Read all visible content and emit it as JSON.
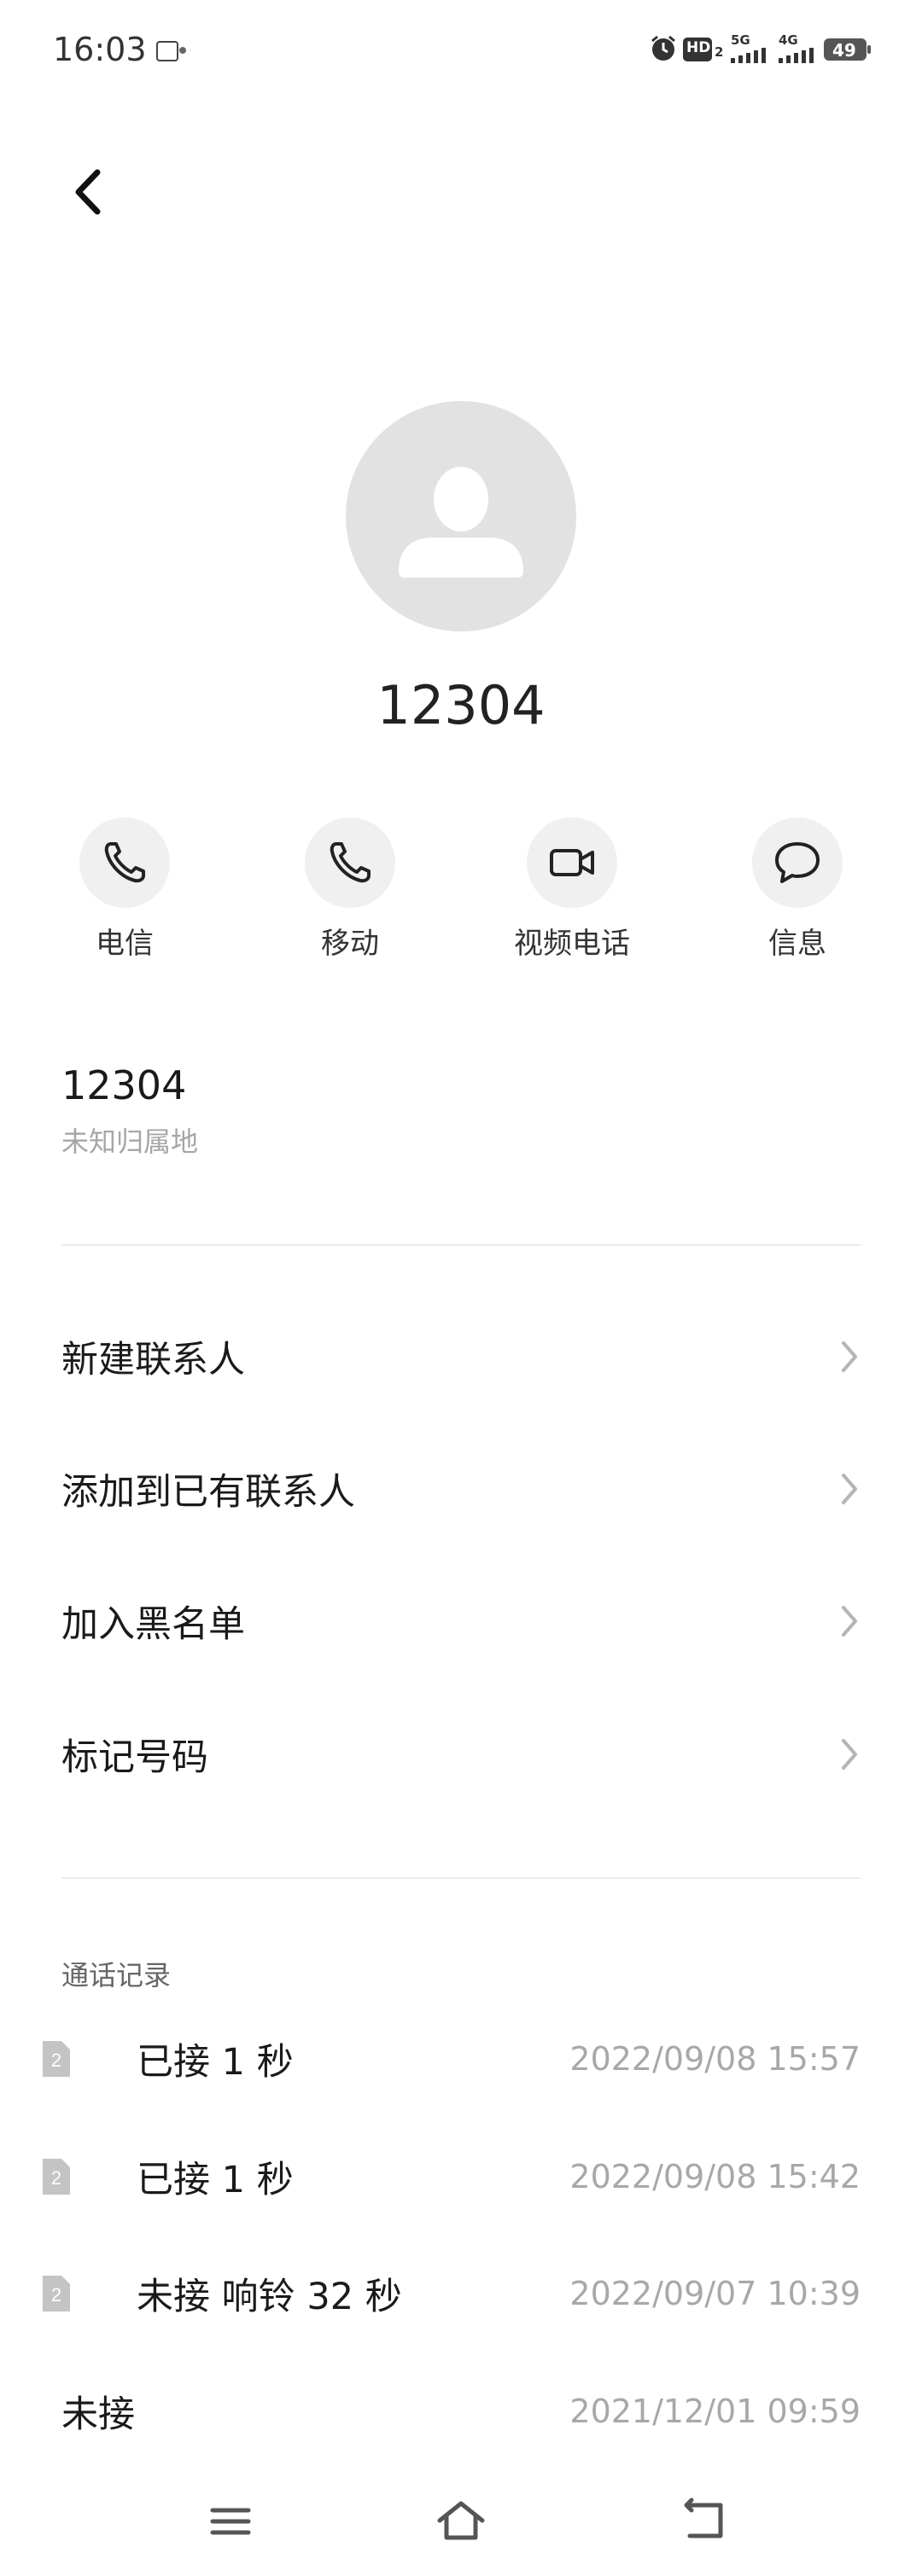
{
  "status_bar": {
    "time": "16:03",
    "hd_label": "HD",
    "hd_sub": "2",
    "signal1_label": "5G",
    "signal2_label": "4G",
    "battery": "49"
  },
  "header": {
    "back_icon": "back-arrow-icon"
  },
  "caller": {
    "number": "12304",
    "avatar_icon": "person-icon"
  },
  "actions": [
    {
      "label": "电信",
      "icon": "phone-icon"
    },
    {
      "label": "移动",
      "icon": "phone-icon"
    },
    {
      "label": "视频电话",
      "icon": "video-icon"
    },
    {
      "label": "信息",
      "icon": "message-icon"
    }
  ],
  "number_info": {
    "number": "12304",
    "location": "未知归属地"
  },
  "menu": [
    {
      "label": "新建联系人"
    },
    {
      "label": "添加到已有联系人"
    },
    {
      "label": "加入黑名单"
    },
    {
      "label": "标记号码"
    }
  ],
  "call_log": {
    "header": "通话记录",
    "entries": [
      {
        "sim": "2",
        "status": "已接 1 秒",
        "time": "2022/09/08 15:57"
      },
      {
        "sim": "2",
        "status": "已接 1 秒",
        "time": "2022/09/08 15:42"
      },
      {
        "sim": "2",
        "status": "未接 响铃 32 秒",
        "time": "2022/09/07 10:39"
      },
      {
        "sim": "",
        "status": "未接",
        "time": "2021/12/01 09:59"
      }
    ]
  },
  "nav": {
    "menu_icon": "menu-icon",
    "home_icon": "home-icon",
    "back_icon": "back-icon"
  }
}
